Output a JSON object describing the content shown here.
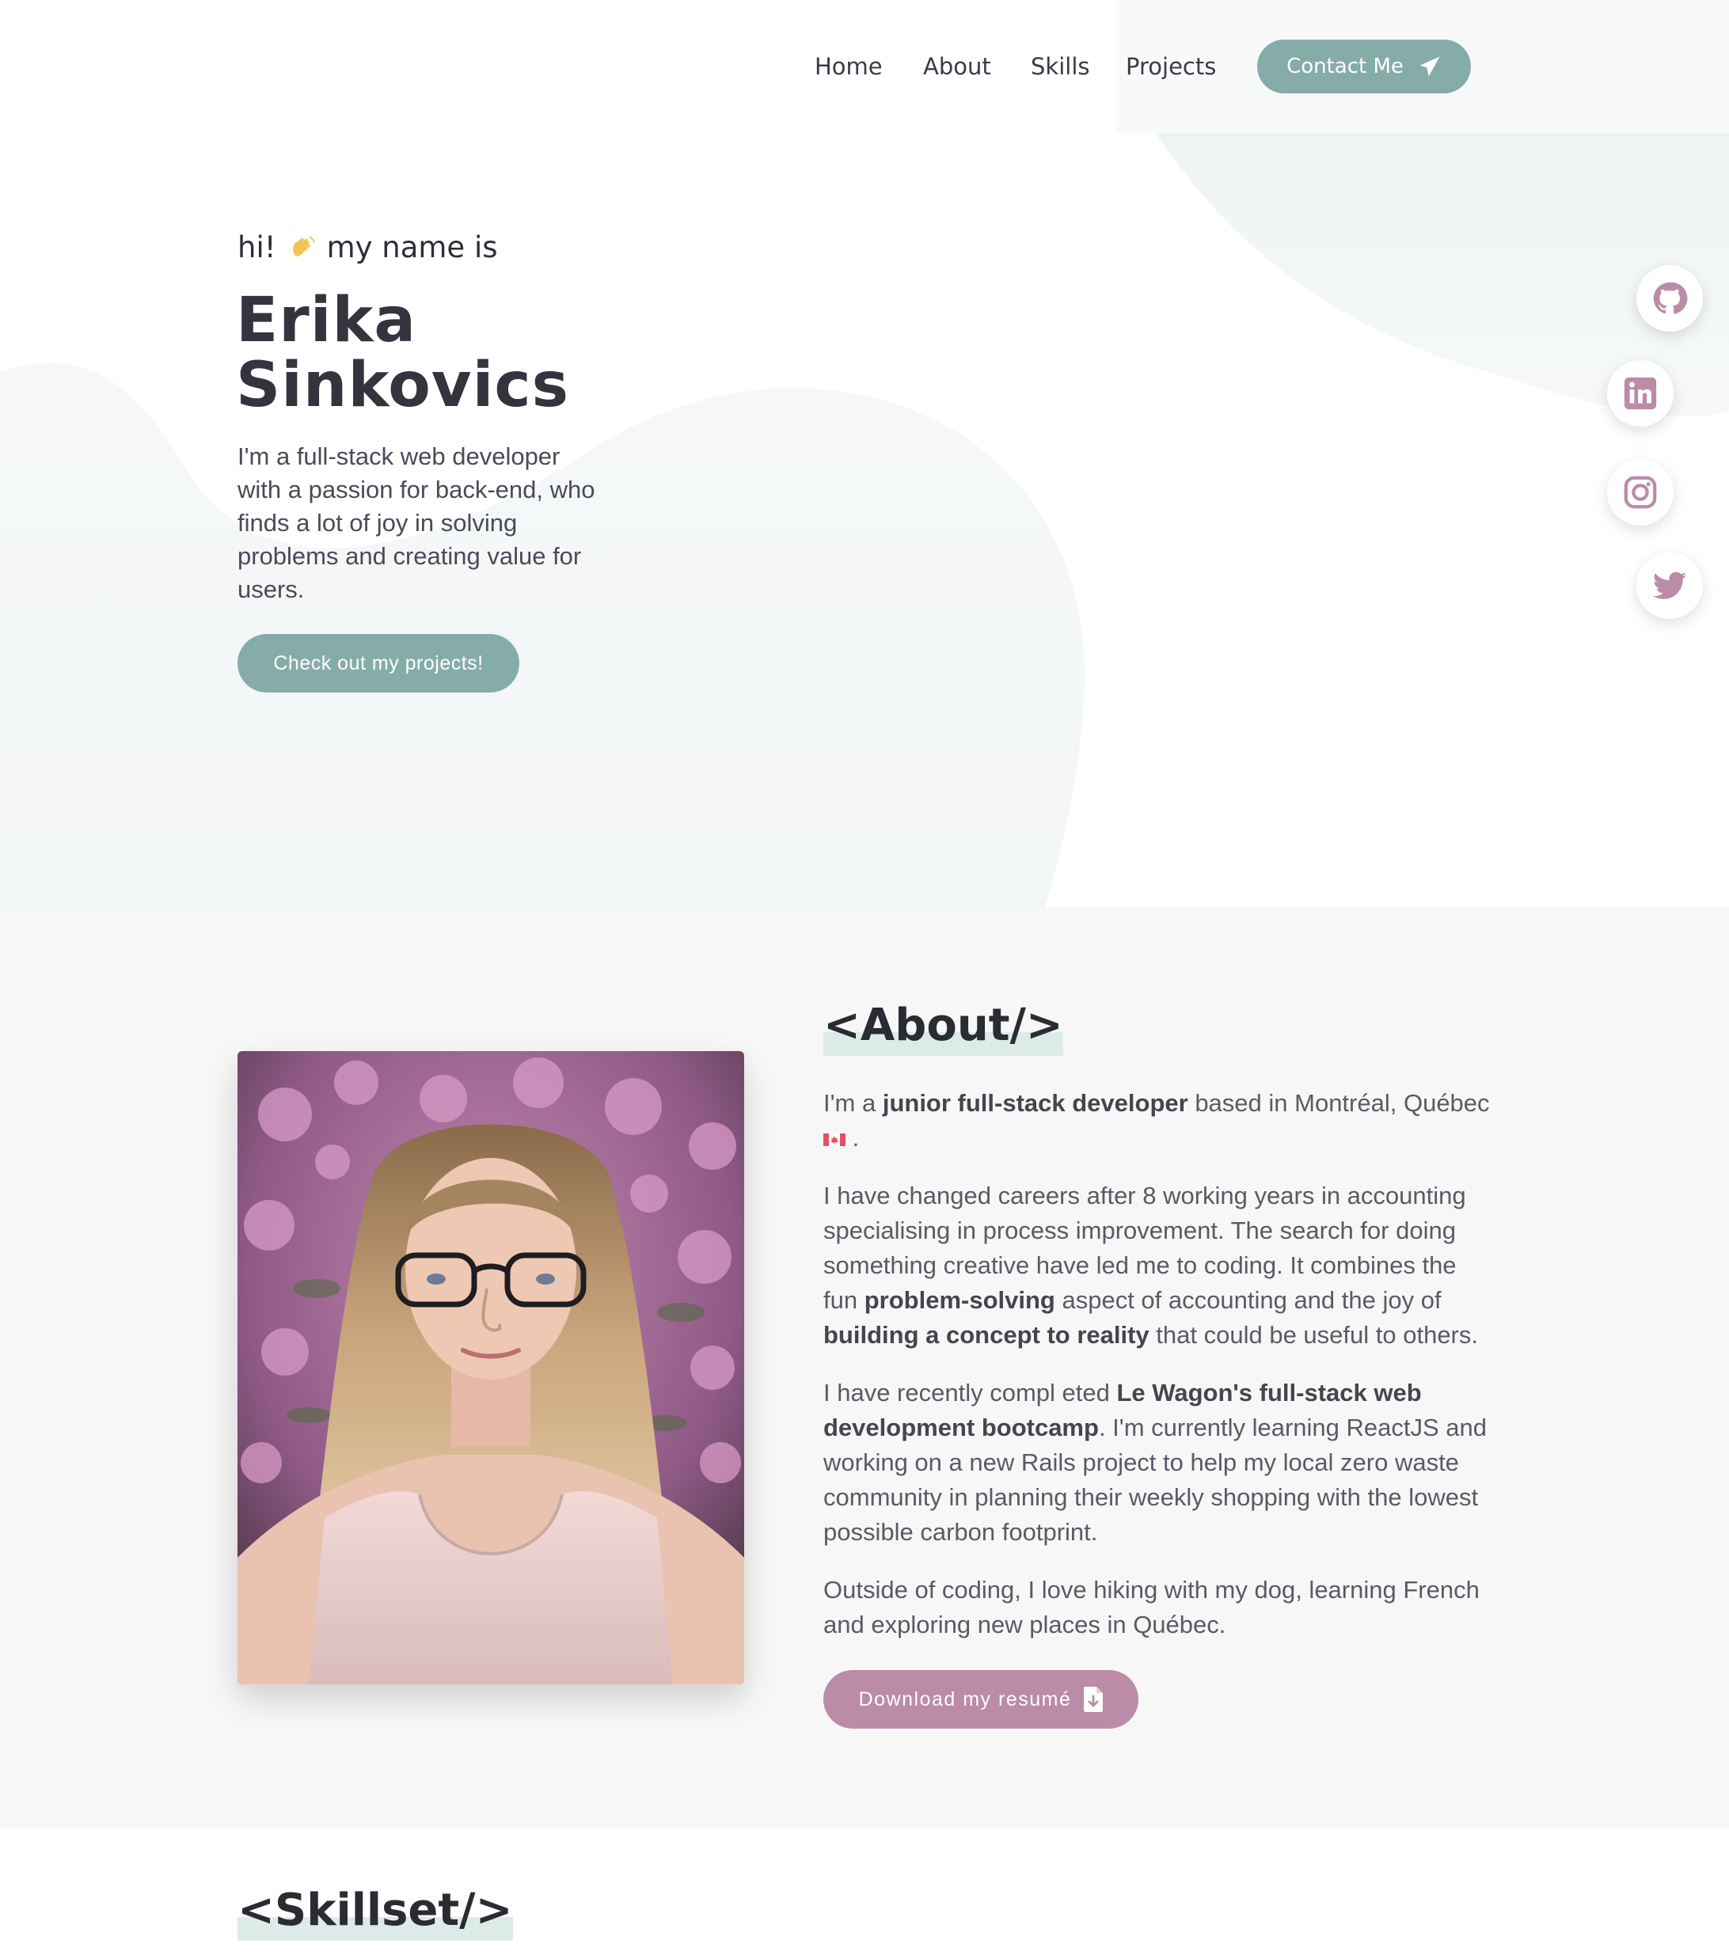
{
  "nav": {
    "home": "Home",
    "about": "About",
    "skills": "Skills",
    "projects": "Projects",
    "contact": "Contact Me"
  },
  "hero": {
    "greeting_pre": "hi!",
    "greeting_post": "my name is",
    "name_first": "Erika",
    "name_last": "Sinkovics",
    "description": "I'm a full-stack web developer with a passion for back-end, who finds a lot of joy in solving problems and creating value for users.",
    "cta": "Check out my projects!"
  },
  "social": [
    "github-icon",
    "linkedin-icon",
    "instagram-icon",
    "twitter-icon"
  ],
  "about": {
    "title_open": "<",
    "title_word": "About",
    "title_close": "/>",
    "p1_a": "I'm a ",
    "p1_b": "junior full-stack developer",
    "p1_c": " based in Montréal, Québec",
    "p1_d": " .",
    "p2_a": "I have changed careers after 8 working years in accounting specialising in process improvement. The search for doing something creative have led me to coding. It combines the fun ",
    "p2_b": "problem-solving",
    "p2_c": " aspect of accounting and the joy of ",
    "p2_d": "building a concept to reality",
    "p2_e": " that could be useful to others.",
    "p3_a": "I have recently compl eted ",
    "p3_b": "Le Wagon's full-stack web development bootcamp",
    "p3_c": ". I'm currently learning ReactJS and working on a new Rails project to help my local zero waste community in planning their weekly shopping with the lowest possible carbon footprint.",
    "p4": "Outside of coding, I love hiking with my dog, learning French and exploring new places in Québec.",
    "resume": "Download my resumé"
  },
  "skills": {
    "title_open": "<",
    "title_word": "Skillset",
    "title_close": "/>"
  },
  "colors": {
    "teal": "#86aca9",
    "pink": "#bb8ba7",
    "dark": "#34343f",
    "about_bg": "#f7f7f7",
    "title_mark": "#dcebe8"
  }
}
